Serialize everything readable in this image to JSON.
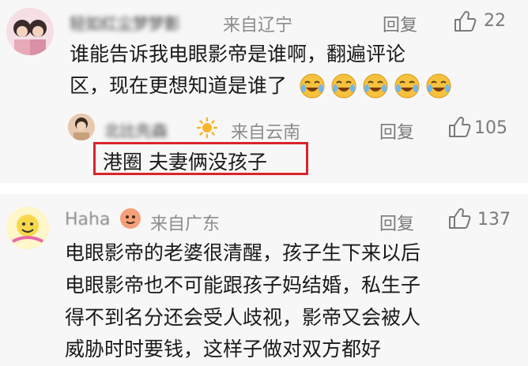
{
  "comment1": {
    "author": "轻如红尘梦梦影",
    "location": "来自辽宁",
    "reply_label": "回复",
    "likes": "22",
    "lines": [
      "谁能告诉我电眼影帝是谁啊，翻遍评论",
      "区，现在更想知道是谁了"
    ],
    "emoji_count": 5,
    "emoji_icon": "laughing-crying-face-icon"
  },
  "reply1": {
    "author": "北比先森",
    "location": "来自云南",
    "reply_label": "回复",
    "likes": "105",
    "text": "港圈 夫妻俩没孩子",
    "highlight_color": "#d9232d"
  },
  "comment2": {
    "author": "Haha",
    "location": "来自广东",
    "reply_label": "回复",
    "likes": "137",
    "lines": [
      "电眼影帝的老婆很清醒，孩子生下来以后",
      "电眼影帝也不可能跟孩子妈结婚，私生子",
      "得不到名分还会受人歧视，影帝又会被人",
      "威胁时时要钱，这样子做对双方都好"
    ]
  }
}
